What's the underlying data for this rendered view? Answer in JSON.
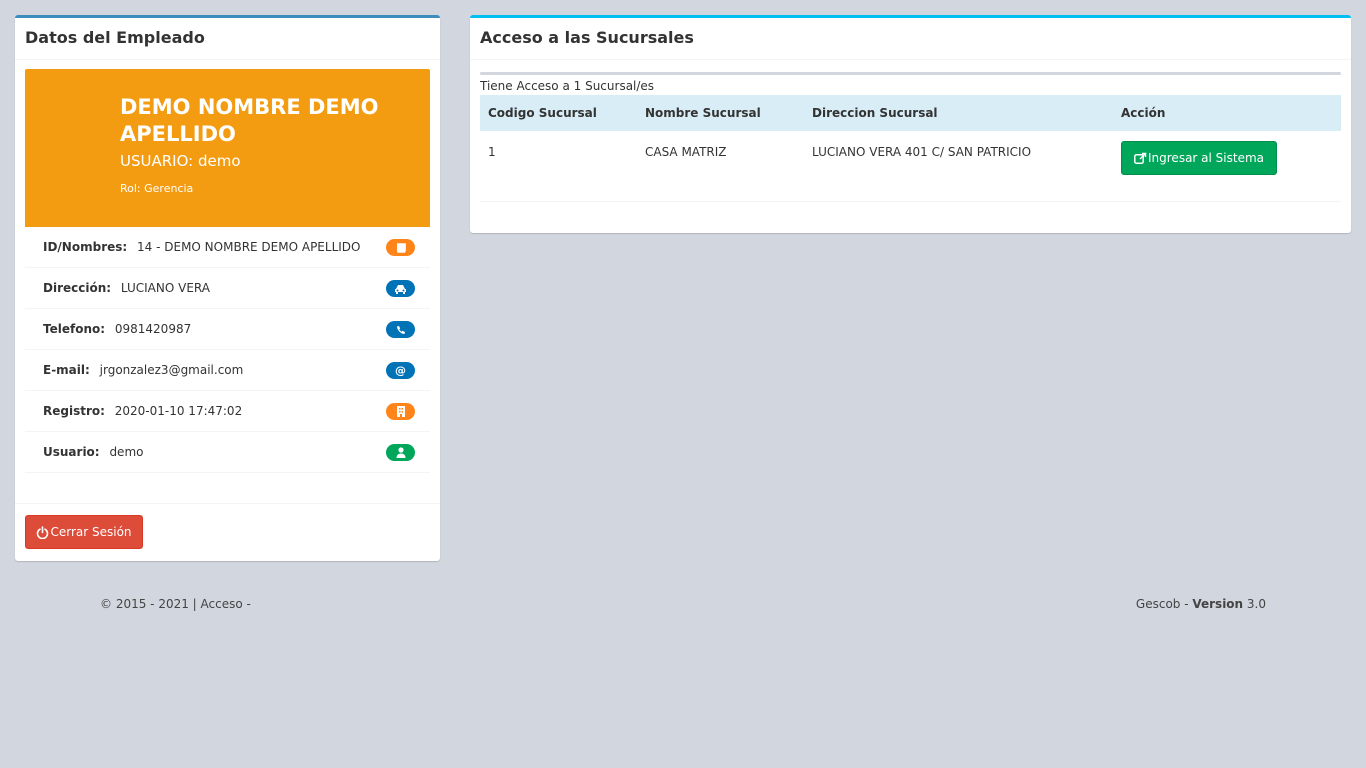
{
  "employee_panel": {
    "title": "Datos del Empleado",
    "name": "DEMO NOMBRE DEMO APELLIDO",
    "user_line": "USUARIO: demo",
    "role_line": "Rol: Gerencia",
    "rows": [
      {
        "label": "ID/Nombres:",
        "value": "14 - DEMO NOMBRE DEMO APELLIDO",
        "icon": "book-icon",
        "color": "#ff851b"
      },
      {
        "label": "Dirección:",
        "value": "LUCIANO VERA",
        "icon": "car-icon",
        "color": "#0073b7"
      },
      {
        "label": "Telefono:",
        "value": "0981420987",
        "icon": "phone-icon",
        "color": "#0073b7"
      },
      {
        "label": "E-mail:",
        "value": "jrgonzalez3@gmail.com",
        "icon": "at-icon",
        "color": "#0073b7"
      },
      {
        "label": "Registro:",
        "value": "2020-01-10 17:47:02",
        "icon": "building-icon",
        "color": "#ff851b"
      },
      {
        "label": "Usuario:",
        "value": "demo",
        "icon": "user-icon",
        "color": "#00a65a"
      }
    ],
    "logout_label": "Cerrar Sesión"
  },
  "branches_panel": {
    "title": "Acceso a las Sucursales",
    "access_count": "Tiene Acceso a 1 Sucursal/es",
    "columns": [
      "Codigo Sucursal",
      "Nombre Sucursal",
      "Direccion Sucursal",
      "Acción"
    ],
    "rows": [
      {
        "code": "1",
        "name": "CASA MATRIZ",
        "address": "LUCIANO VERA 401 C/ SAN PATRICIO",
        "action_label": "Ingresar al Sistema"
      }
    ]
  },
  "footer": {
    "left": "© 2015 - 2021 | Acceso -",
    "brand": "Gescob - ",
    "version_label": "Version",
    "version_number": " 3.0"
  },
  "colors": {
    "accent_left": "#3c8dbc",
    "accent_right": "#00c0ef",
    "widget_orange": "#f39c12",
    "danger": "#dd4b39",
    "success": "#00a65a"
  }
}
